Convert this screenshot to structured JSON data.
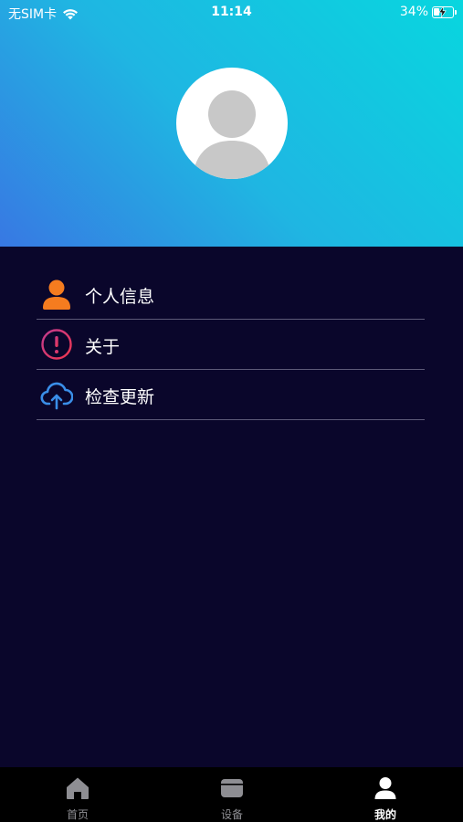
{
  "status_bar": {
    "carrier": "无SIM卡",
    "time": "11:14",
    "battery": "34%",
    "battery_level": 0.34
  },
  "profile": {
    "avatar_icon": "avatar-placeholder-icon"
  },
  "menu": {
    "items": [
      {
        "label": "个人信息",
        "icon": "person-icon",
        "color": "#f57c1f"
      },
      {
        "label": "关于",
        "icon": "exclamation-circle-icon",
        "color": "#e23a5f"
      },
      {
        "label": "检查更新",
        "icon": "cloud-upload-icon",
        "color": "#3a8ee8"
      }
    ]
  },
  "tabbar": {
    "tabs": [
      {
        "label": "首页",
        "icon": "home-icon"
      },
      {
        "label": "设备",
        "icon": "device-icon"
      },
      {
        "label": "我的",
        "icon": "person-icon",
        "active": true
      }
    ]
  },
  "colors": {
    "background": "#0a062b",
    "header_gradient_start": "#3878e3",
    "header_gradient_end": "#08d6df",
    "tabbar": "#000000"
  }
}
